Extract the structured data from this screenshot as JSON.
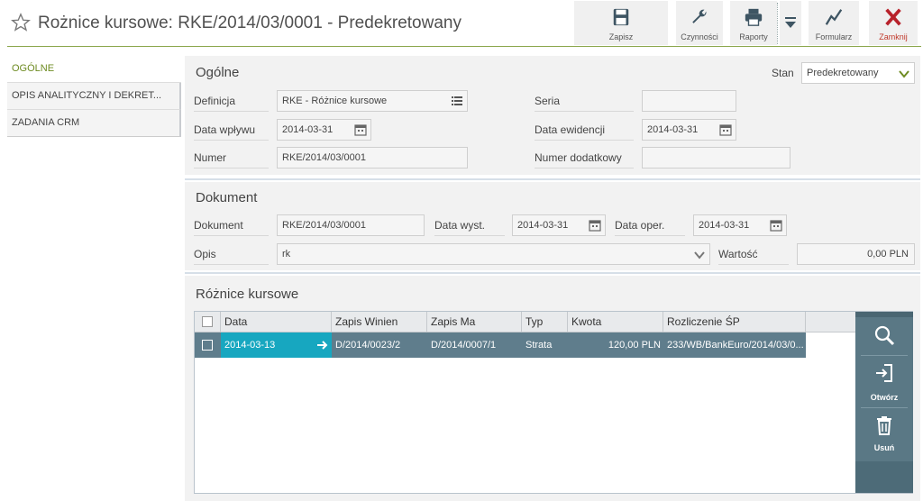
{
  "header": {
    "title": "Rożnice kursowe: RKE/2014/03/0001 - Predekretowany"
  },
  "toolbar": {
    "save": "Zapisz",
    "actions": "Czynności",
    "reports": "Raporty",
    "form": "Formularz",
    "close": "Zamknij"
  },
  "tabs": {
    "general": "OGÓLNE",
    "analytic": "OPIS ANALITYCZNY I DEKRET...",
    "crm": "ZADANIA CRM"
  },
  "general": {
    "title": "Ogólne",
    "status_label": "Stan",
    "status_value": "Predekretowany",
    "definition_label": "Definicja",
    "definition_value": "RKE - Różnice kursowe",
    "series_label": "Seria",
    "series_value": "",
    "receipt_date_label": "Data wpływu",
    "receipt_date_value": "2014-03-31",
    "record_date_label": "Data ewidencji",
    "record_date_value": "2014-03-31",
    "number_label": "Numer",
    "number_value": "RKE/2014/03/0001",
    "extra_number_label": "Numer dodatkowy",
    "extra_number_value": ""
  },
  "document": {
    "title": "Dokument",
    "doc_label": "Dokument",
    "doc_value": "RKE/2014/03/0001",
    "issue_date_label": "Data wyst.",
    "issue_date_value": "2014-03-31",
    "op_date_label": "Data oper.",
    "op_date_value": "2014-03-31",
    "desc_label": "Opis",
    "desc_value": "rk",
    "value_label": "Wartość",
    "value_value": "0,00 PLN"
  },
  "diffs": {
    "title": "Różnice kursowe",
    "columns": [
      "Data",
      "Zapis Winien",
      "Zapis Ma",
      "Typ",
      "Kwota",
      "Rozliczenie ŚP"
    ],
    "rows": [
      {
        "date": "2014-03-13",
        "debit": "D/2014/0023/2",
        "credit": "D/2014/0007/1",
        "type": "Strata",
        "amount": "120,00 PLN",
        "settlement": "233/WB/BankEuro/2014/03/0..."
      }
    ],
    "side": {
      "open": "Otwórz",
      "delete": "Usuń"
    }
  },
  "colors": {
    "accent_green": "#6e8b22",
    "row_selected": "#5f7d8c",
    "cell_highlight": "#17a7c0",
    "close_red": "#c0392b",
    "side_panel": "#5a7885"
  },
  "icons": [
    "star-icon",
    "save-icon",
    "wrench-icon",
    "printer-icon",
    "chevron-down-icon",
    "chart-icon",
    "close-icon",
    "calendar-icon",
    "list-icon",
    "search-icon",
    "open-icon",
    "trash-icon",
    "arrow-right-icon"
  ]
}
